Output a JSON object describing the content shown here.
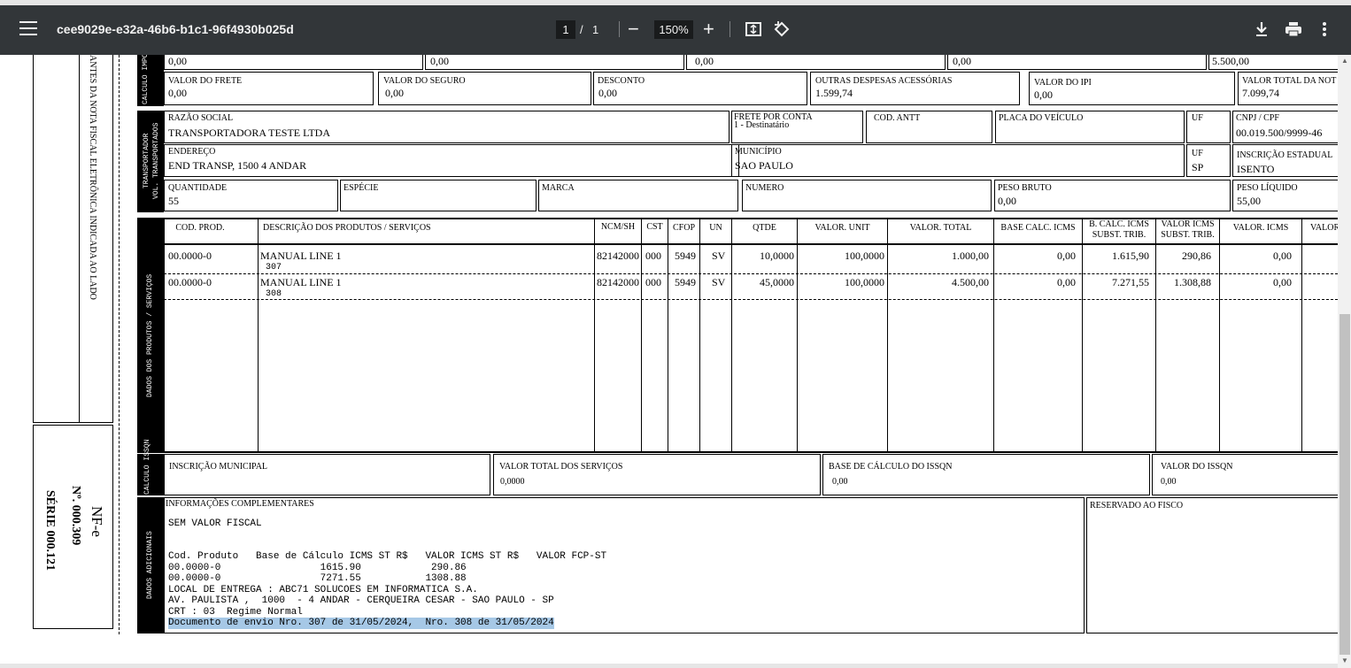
{
  "viewer": {
    "title": "cee9029e-e32a-46b6-b1c1-96f4930b025d",
    "page_current": "1",
    "page_sep": "/",
    "page_total": "1",
    "zoom": "150%",
    "minus": "−",
    "plus": "+"
  },
  "stub": {
    "text": "ANTES DA NOTA FISCAL ELETRÔNICA INDICADA AO LADO",
    "nfe": "NF-e",
    "numero": "Nº.  000.309",
    "serie": "SÉRIE 000.121"
  },
  "calc": {
    "side": "CÁLCULO IMPOSTO",
    "row1": [
      "0,00",
      "0,00",
      "0,00",
      "0,00",
      "5.500,00"
    ],
    "frete_l": "VALOR DO FRETE",
    "frete_v": "0,00",
    "seguro_l": "VALOR DO SEGURO",
    "seguro_v": "0,00",
    "desc_l": "DESCONTO",
    "desc_v": "0,00",
    "outras_l": "OUTRAS DESPESAS ACESSÓRIAS",
    "outras_v": "1.599,74",
    "ipi_l": "VALOR DO IPI",
    "ipi_v": "0,00",
    "total_l": "VALOR TOTAL DA NOT",
    "total_v": "7.099,74"
  },
  "transp": {
    "side1": "TRANSPORTADOR",
    "side2": "VOL. TRANSPORTADOS",
    "razao_l": "RAZÃO SOCIAL",
    "razao_v": "TRANSPORTADORA TESTE  LTDA",
    "frete_l": "FRETE POR CONTA",
    "frete_v": "1 - Destinatário",
    "antt_l": "COD. ANTT",
    "placa_l": "PLACA DO VEÍCULO",
    "uf_l": "UF",
    "cnpj_l": "CNPJ / CPF",
    "cnpj_v": "00.019.500/9999-46",
    "end_l": "ENDEREÇO",
    "end_v": "END TRANSP, 1500 4 ANDAR",
    "mun_l": "MUNICÍPIO",
    "mun_v": "SAO PAULO",
    "uf2_l": "UF",
    "uf2_v": "SP",
    "ie_l": "INSCRIÇÃO ESTADUAL",
    "ie_v": "ISENTO",
    "qtd_l": "QUANTIDADE",
    "qtd_v": "55",
    "esp_l": "ESPÉCIE",
    "marca_l": "MARCA",
    "num_l": "NUMERO",
    "pb_l": "PESO BRUTO",
    "pb_v": "0,00",
    "pl_l": "PESO LÍQUIDO",
    "pl_v": "55,00"
  },
  "produtos": {
    "side": "DADOS DOS PRODUTOS / SERVIÇOS",
    "headers": {
      "cod": "COD. PROD.",
      "desc": "DESCRIÇÃO DOS PRODUTOS / SERVIÇOS",
      "ncm": "NCM/SH",
      "cst": "CST",
      "cfop": "CFOP",
      "un": "UN",
      "qtde": "QTDE",
      "vunit": "VALOR. UNIT",
      "vtotal": "VALOR. TOTAL",
      "bcicms": "BASE CALC. ICMS",
      "bcst1": "B. CALC. ICMS",
      "bcst2": "SUBST. TRIB.",
      "vst1": "VALOR ICMS",
      "vst2": "SUBST. TRIB.",
      "vicms": "VALOR. ICMS",
      "valor": "VALOR"
    },
    "rows": [
      {
        "cod": "00.0000-0",
        "desc": "MANUAL LINE 1",
        "sub": "307",
        "ncm": "82142000",
        "cst": "000",
        "cfop": "5949",
        "un": "SV",
        "qtde": "10,0000",
        "vunit": "100,0000",
        "vtotal": "1.000,00",
        "bcicms": "0,00",
        "bcst": "1.615,90",
        "vst": "290,86",
        "vicms": "0,00"
      },
      {
        "cod": "00.0000-0",
        "desc": "MANUAL LINE 1",
        "sub": "308",
        "ncm": "82142000",
        "cst": "000",
        "cfop": "5949",
        "un": "SV",
        "qtde": "45,0000",
        "vunit": "100,0000",
        "vtotal": "4.500,00",
        "bcicms": "0,00",
        "bcst": "7.271,55",
        "vst": "1.308,88",
        "vicms": "0,00"
      }
    ]
  },
  "issqn": {
    "side": "CÁLCULO ISSQN",
    "im_l": "INSCRIÇÃO MUNICIPAL",
    "vts_l": "VALOR TOTAL DOS SERVIÇOS",
    "vts_v": "0,0000",
    "base_l": "BASE DE CÁLCULO DO ISSQN",
    "base_v": "0,00",
    "viss_l": "VALOR DO ISSQN",
    "viss_v": "0,00"
  },
  "adic": {
    "side": "DADOS ADICIONAIS",
    "info_l": "INFORMAÇÕES COMPLEMENTARES",
    "lines": [
      "SEM VALOR FISCAL",
      "",
      "",
      "Cod. Produto   Base de Cálculo ICMS ST R$   VALOR ICMS ST R$   VALOR FCP-ST",
      "00.0000-0                 1615.90            290.86",
      "00.0000-0                 7271.55           1308.88",
      "LOCAL DE ENTREGA : ABC71 SOLUCOES EM INFORMATICA S.A.",
      "AV. PAULISTA ,  1000  - 4 ANDAR - CERQUEIRA CESAR - SAO PAULO - SP",
      "CRT : 03  Regime Normal"
    ],
    "highlight": "Documento de envio Nro. 307 de 31/05/2024,  Nro. 308 de 31/05/2024",
    "fisco_l": "RESERVADO AO FISCO"
  }
}
